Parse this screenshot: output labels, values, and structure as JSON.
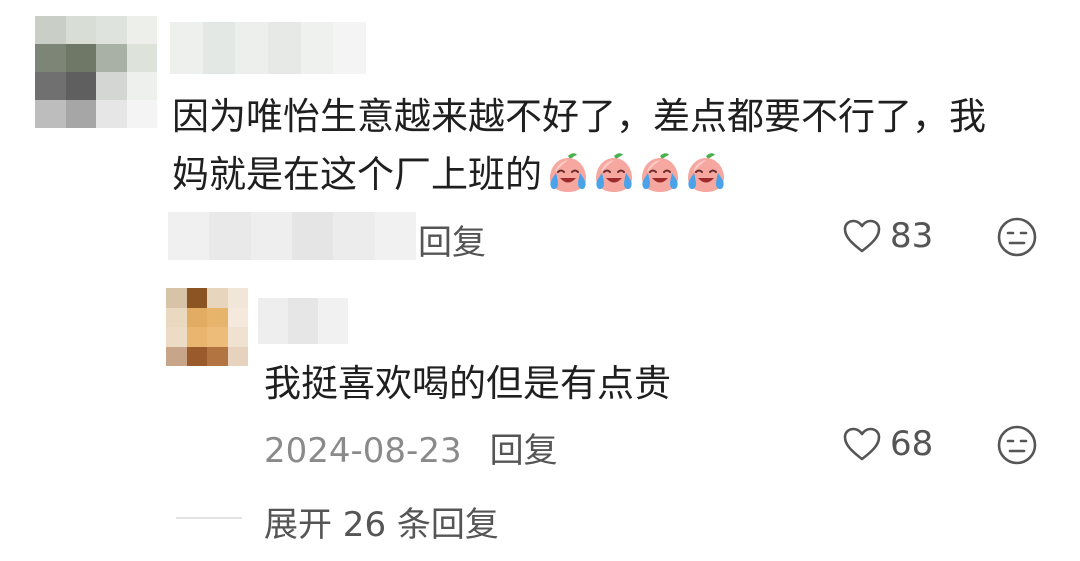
{
  "comment": {
    "text_line1": "因为唯怡生意越来越不好了，差点都要不行了，我",
    "text_line2": "妈就是在这个厂上班的",
    "emoji_count": 4,
    "emoji_name": "crying-peach-emoji",
    "reply_label": "回复",
    "like_count": "83"
  },
  "reply": {
    "text": "我挺喜欢喝的但是有点贵",
    "date": "2024-08-23",
    "reply_label": "回复",
    "like_count": "68"
  },
  "expand": {
    "label": "展开 26 条回复"
  },
  "icons": {
    "like": "heart-outline-icon",
    "dislike": "neutral-face-icon"
  },
  "colors": {
    "text": "#1f1f1f",
    "secondary": "#8a8a8a",
    "action": "#555555"
  }
}
